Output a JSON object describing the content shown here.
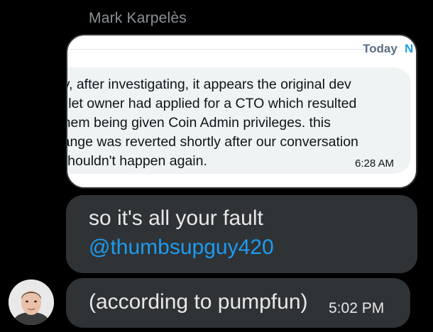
{
  "sender": {
    "name": "Mark Karpelès"
  },
  "screenshot": {
    "day_label": "Today",
    "new_label": "N",
    "lines": [
      "hey, after investigating, it appears the original dev",
      "wallet owner had applied for a CTO which resulted",
      "n them being given Coin Admin privileges. this",
      "change was reverted shortly after our conversation",
      "& shouldn't happen again."
    ],
    "time": "6:28 AM"
  },
  "messages": [
    {
      "text": "so it's all your fault",
      "mention": "@thumbsupguy420"
    },
    {
      "text": "(according to pumpfun)",
      "time": "5:02 PM"
    }
  ],
  "colors": {
    "background": "#000000",
    "bubble": "#2f3336",
    "mention": "#1d9bf0",
    "name": "#8b9197"
  }
}
